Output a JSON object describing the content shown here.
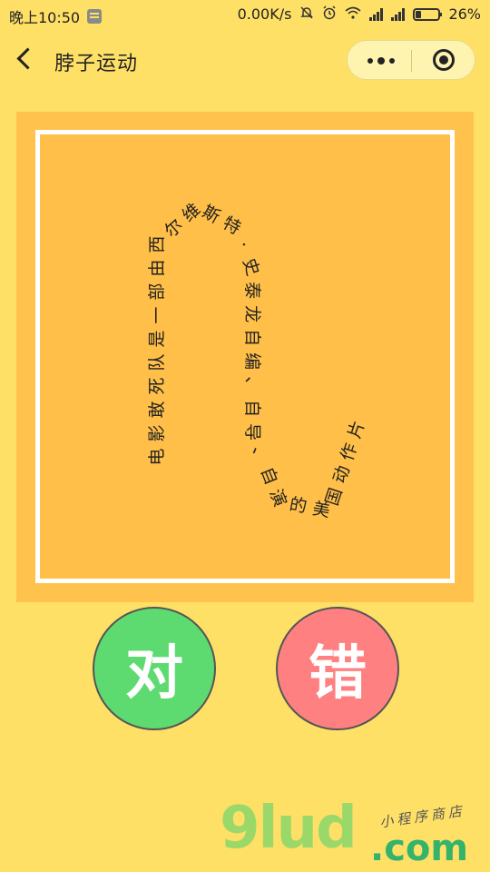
{
  "status_bar": {
    "time": "晚上10:50",
    "network_speed": "0.00K/s",
    "battery": "26%",
    "icons": [
      "sim-icon",
      "mute-icon",
      "alarm-icon",
      "wifi-icon",
      "signal-icon",
      "battery-icon"
    ]
  },
  "nav": {
    "title": "脖子运动",
    "back_icon": "chevron-left-icon",
    "capsule_more_icon": "more-dots-icon",
    "capsule_close_icon": "target-circle-icon"
  },
  "card": {
    "question": "电影敢死队是一部由西尔维斯特·史泰龙自编、自导、自演的美国动作片"
  },
  "buttons": {
    "correct": "对",
    "wrong": "错"
  },
  "watermark": {
    "main": "9lud",
    "suffix": ".com",
    "sub": "小程序商店"
  },
  "colors": {
    "background": "#FFE066",
    "card_outer": "#FFC24D",
    "card_border": "#FFFFFF",
    "correct_button": "#5EDB70",
    "wrong_button": "#FF8080"
  }
}
